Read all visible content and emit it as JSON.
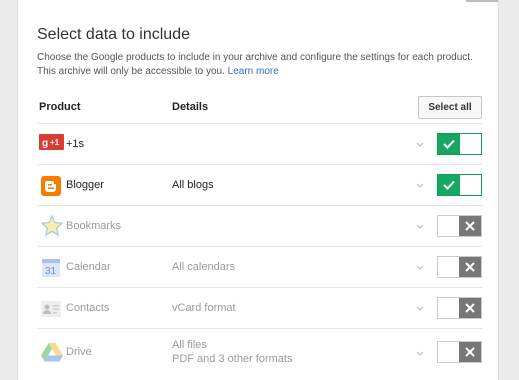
{
  "header": {
    "title": "Select data to include",
    "description": "Choose the Google products to include in your archive and configure the settings for each product. This archive will only be accessible to you.",
    "learn_more": "Learn more"
  },
  "table": {
    "col_product": "Product",
    "col_details": "Details",
    "select_all_label": "Select all",
    "rows": [
      {
        "name": "+1s",
        "details": "",
        "details_line2": "",
        "enabled": true,
        "icon": "google-plus-one-icon"
      },
      {
        "name": "Blogger",
        "details": "All blogs",
        "details_line2": "",
        "enabled": true,
        "icon": "blogger-icon"
      },
      {
        "name": "Bookmarks",
        "details": "",
        "details_line2": "",
        "enabled": false,
        "icon": "bookmarks-star-icon"
      },
      {
        "name": "Calendar",
        "details": "All calendars",
        "details_line2": "",
        "enabled": false,
        "icon": "calendar-icon"
      },
      {
        "name": "Contacts",
        "details": "vCard format",
        "details_line2": "",
        "enabled": false,
        "icon": "contacts-icon"
      },
      {
        "name": "Drive",
        "details": "All files",
        "details_line2": "PDF and 3 other formats",
        "enabled": false,
        "icon": "drive-icon"
      }
    ]
  },
  "colors": {
    "toggle_on": "#16a765",
    "toggle_off": "#777777",
    "link": "#2f6ec5"
  }
}
